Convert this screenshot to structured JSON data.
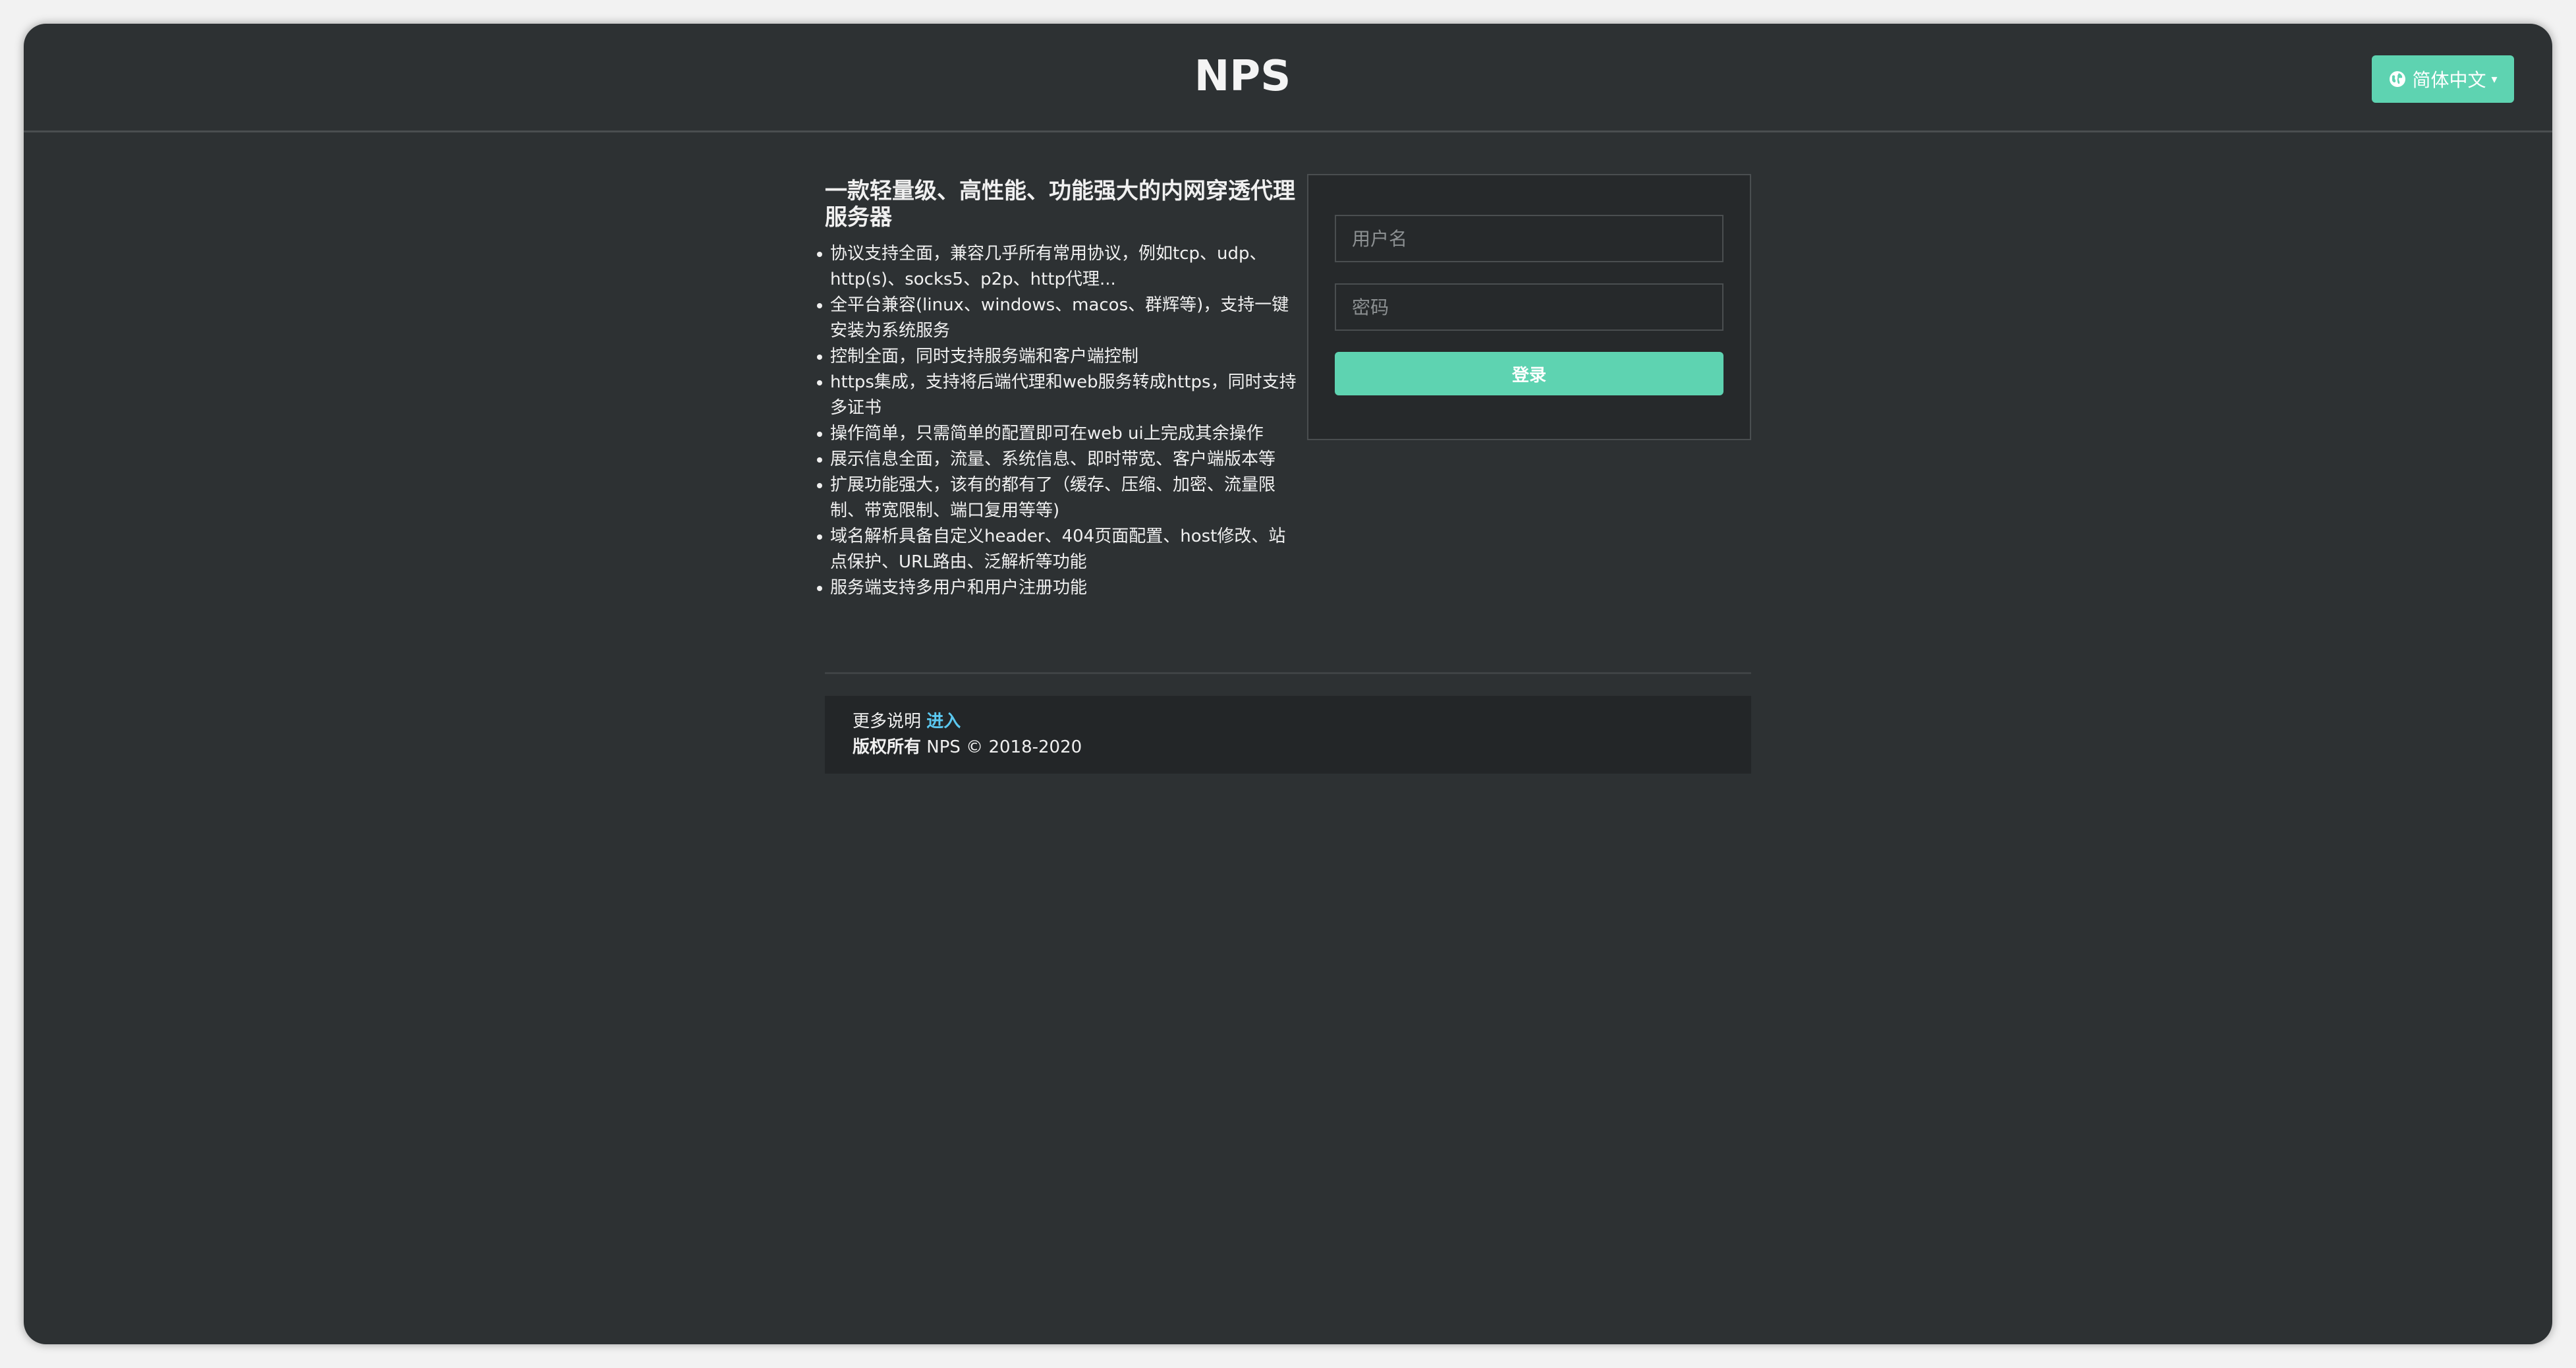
{
  "header": {
    "brand": "NPS",
    "language_label": "简体中文"
  },
  "intro": {
    "title": "一款轻量级、高性能、功能强大的内网穿透代理服务器",
    "features": [
      "协议支持全面，兼容几乎所有常用协议，例如tcp、udp、http(s)、socks5、p2p、http代理...",
      "全平台兼容(linux、windows、macos、群辉等)，支持一键安装为系统服务",
      "控制全面，同时支持服务端和客户端控制",
      "https集成，支持将后端代理和web服务转成https，同时支持多证书",
      "操作简单，只需简单的配置即可在web ui上完成其余操作",
      "展示信息全面，流量、系统信息、即时带宽、客户端版本等",
      "扩展功能强大，该有的都有了（缓存、压缩、加密、流量限制、带宽限制、端口复用等等)",
      "域名解析具备自定义header、404页面配置、host修改、站点保护、URL路由、泛解析等功能",
      "服务端支持多用户和用户注册功能"
    ]
  },
  "login": {
    "username_placeholder": "用户名",
    "password_placeholder": "密码",
    "submit_label": "登录"
  },
  "footer": {
    "more_info_label": "更多说明",
    "more_info_link": "进入",
    "copyright_label": "版权所有",
    "copyright_text": "NPS © 2018-2020"
  },
  "colors": {
    "accent": "#5ed3b1",
    "background": "#2d3133",
    "link": "#5bc8f0"
  },
  "icons": {
    "language": "globe-icon",
    "dropdown": "caret-down-icon"
  }
}
